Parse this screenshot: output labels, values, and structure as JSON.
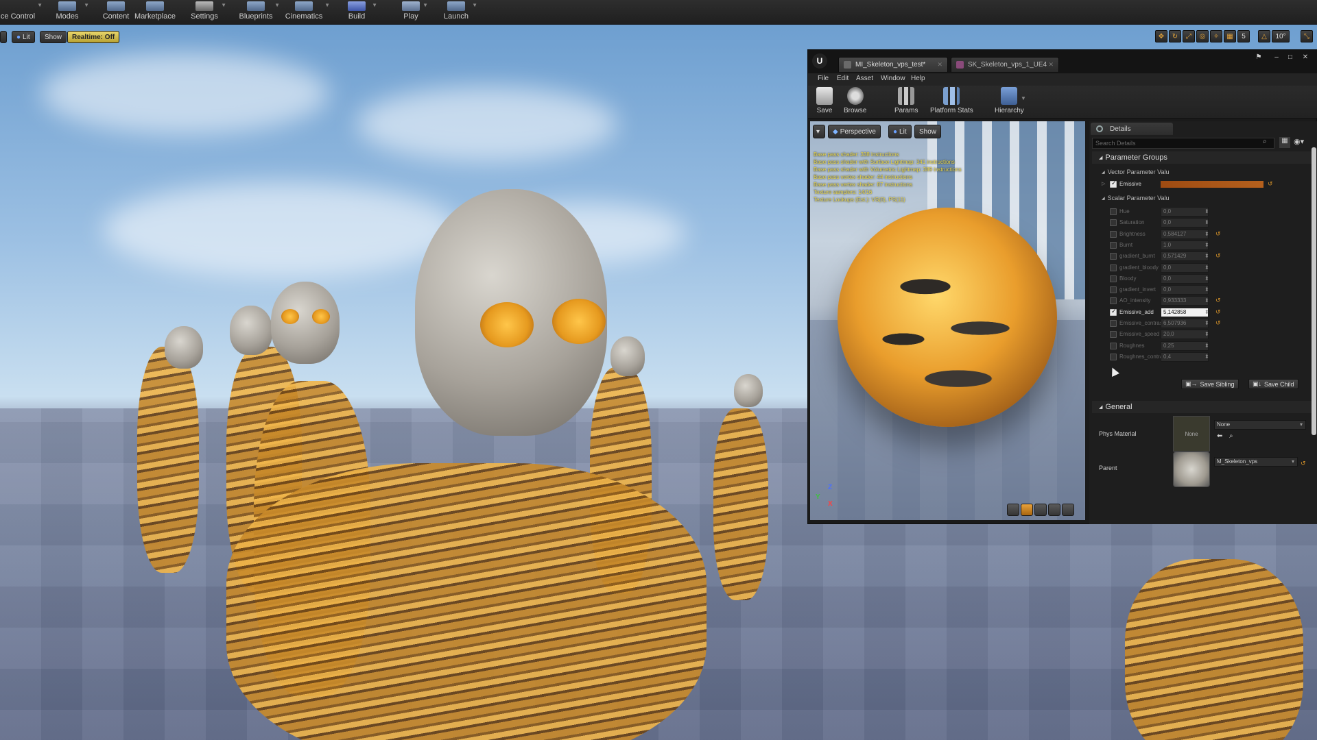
{
  "main_toolbar": {
    "items": [
      {
        "label": "ce Control"
      },
      {
        "label": "Modes"
      },
      {
        "label": "Content"
      },
      {
        "label": "Marketplace"
      },
      {
        "label": "Settings"
      },
      {
        "label": "Blueprints"
      },
      {
        "label": "Cinematics"
      },
      {
        "label": "Build"
      },
      {
        "label": "Play"
      },
      {
        "label": "Launch"
      }
    ]
  },
  "viewport": {
    "lit_label": "Lit",
    "show_label": "Show",
    "realtime_label": "Realtime: Off",
    "snap_value": "5",
    "rotation_snap": "10°"
  },
  "material_editor": {
    "tabs": [
      {
        "label": "MI_Skeleton_vps_test*"
      },
      {
        "label": "SK_Skeleton_vps_1_UE4"
      }
    ],
    "menu": [
      "File",
      "Edit",
      "Asset",
      "Window",
      "Help"
    ],
    "toolbar": {
      "save": "Save",
      "browse": "Browse",
      "params": "Params",
      "platform_stats": "Platform Stats",
      "hierarchy": "Hierarchy"
    },
    "preview": {
      "perspective_label": "Perspective",
      "lit_label": "Lit",
      "show_label": "Show",
      "stats": "Base pass shader: 338 instructions\nBase pass shader with Surface Lightmap: 341 instructions\nBase pass shader with Volumetric Lightmap: 389 instructions\nBase pass vertex shader: 44 instructions\nBase pass vertex shader: 87 instructions\nTexture samplers: 14/16\nTexture Lookups (Est.): VS(0), PS(11)",
      "axis_z": "Z",
      "axis_y": "Y",
      "axis_x": "X"
    },
    "details": {
      "tab_label": "Details",
      "search_placeholder": "Search Details",
      "parameter_groups": "Parameter Groups",
      "vector_header": "Vector Parameter Valu",
      "emissive_label": "Emissive",
      "emissive_color": "#a8541a",
      "scalar_header": "Scalar Parameter Valu",
      "scalar_params": [
        {
          "name": "Hue",
          "value": "0,0",
          "checked": false
        },
        {
          "name": "Saturation",
          "value": "0,0",
          "checked": false
        },
        {
          "name": "Brightness",
          "value": "0,584127",
          "checked": false
        },
        {
          "name": "Burnt",
          "value": "1,0",
          "checked": false
        },
        {
          "name": "gradient_burnt",
          "value": "0,571429",
          "checked": false
        },
        {
          "name": "gradient_bloody",
          "value": "0,0",
          "checked": false
        },
        {
          "name": "Bloody",
          "value": "0,0",
          "checked": false
        },
        {
          "name": "gradient_invert",
          "value": "0,0",
          "checked": false
        },
        {
          "name": "AO_intensity",
          "value": "0,933333",
          "checked": false
        },
        {
          "name": "Emissive_add",
          "value": "5,142858",
          "checked": true
        },
        {
          "name": "Emissive_contrast",
          "value": "6,507936",
          "checked": false
        },
        {
          "name": "Emissive_speed",
          "value": "20,0",
          "checked": false
        },
        {
          "name": "Roughnes",
          "value": "0,25",
          "checked": false
        },
        {
          "name": "Roughnes_contras",
          "value": "0,4",
          "checked": false
        }
      ],
      "save_sibling": "Save Sibling",
      "save_child": "Save Child",
      "general_header": "General",
      "phys_material_label": "Phys Material",
      "phys_material_thumb": "None",
      "phys_material_value": "None",
      "parent_label": "Parent",
      "parent_value": "M_Skeleton_vps"
    }
  }
}
